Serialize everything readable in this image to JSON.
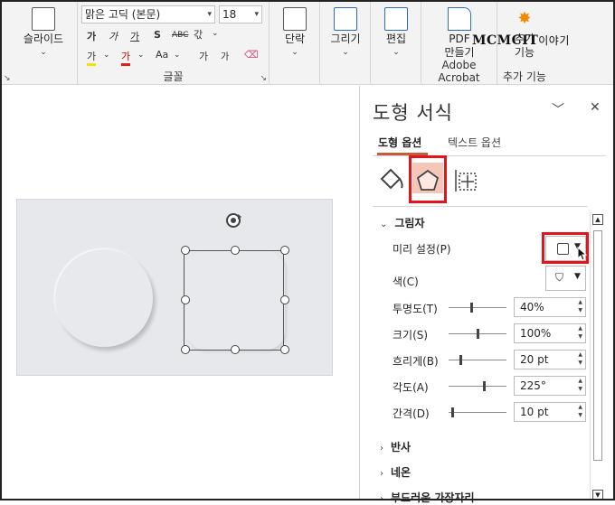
{
  "ribbon": {
    "slide_layout": {
      "label": "슬라이드"
    },
    "font": {
      "font_name": "맑은 고딕 (본문)",
      "font_size": "18",
      "bold": "가",
      "italic": "가",
      "underline": "가",
      "shadow": "S",
      "strikethrough": "ABC",
      "char_spacing": "갃",
      "highlight": "가",
      "font_color": "가",
      "change_case": "Aa",
      "grow": "가",
      "shrink": "가",
      "group_label": "글꼴"
    },
    "paragraph": {
      "label": "단락"
    },
    "drawing": {
      "label": "그리기"
    },
    "editing": {
      "label": "편집"
    },
    "pdf": {
      "label_line1": "PDF",
      "label_line2": "만들기",
      "group_label": "Adobe Acrobat"
    },
    "addins": {
      "label_line1": "추가",
      "label_line2": "기능",
      "group_label": "추가 기능"
    }
  },
  "watermark": {
    "brand": "MCMC",
    "mark": "IT",
    "suffix": "이야기"
  },
  "pane": {
    "title": "도형 서식",
    "tabs": [
      {
        "label": "도형 옵션",
        "active": true
      },
      {
        "label": "텍스트 옵션",
        "active": false
      }
    ],
    "sections": {
      "shadow": "그림자",
      "reflection": "반사",
      "glow": "네온",
      "soft_edges": "부드러운 가장자리"
    },
    "properties": {
      "presets": "미리 설정(P)",
      "color": "색(C)",
      "transparency": {
        "label": "투명도(T)",
        "value": "40%",
        "fraction": 0.4
      },
      "size": {
        "label": "크기(S)",
        "value": "100%",
        "fraction": 0.5
      },
      "blur": {
        "label": "흐리게(B)",
        "value": "20 pt",
        "fraction": 0.2
      },
      "angle": {
        "label": "각도(A)",
        "value": "225°",
        "fraction": 0.625
      },
      "distance": {
        "label": "간격(D)",
        "value": "10 pt",
        "fraction": 0.05
      }
    }
  },
  "colors": {
    "highlight_red": "#e4141b",
    "accent": "#c65a3a",
    "slide_bg": "#e6e8eb"
  }
}
